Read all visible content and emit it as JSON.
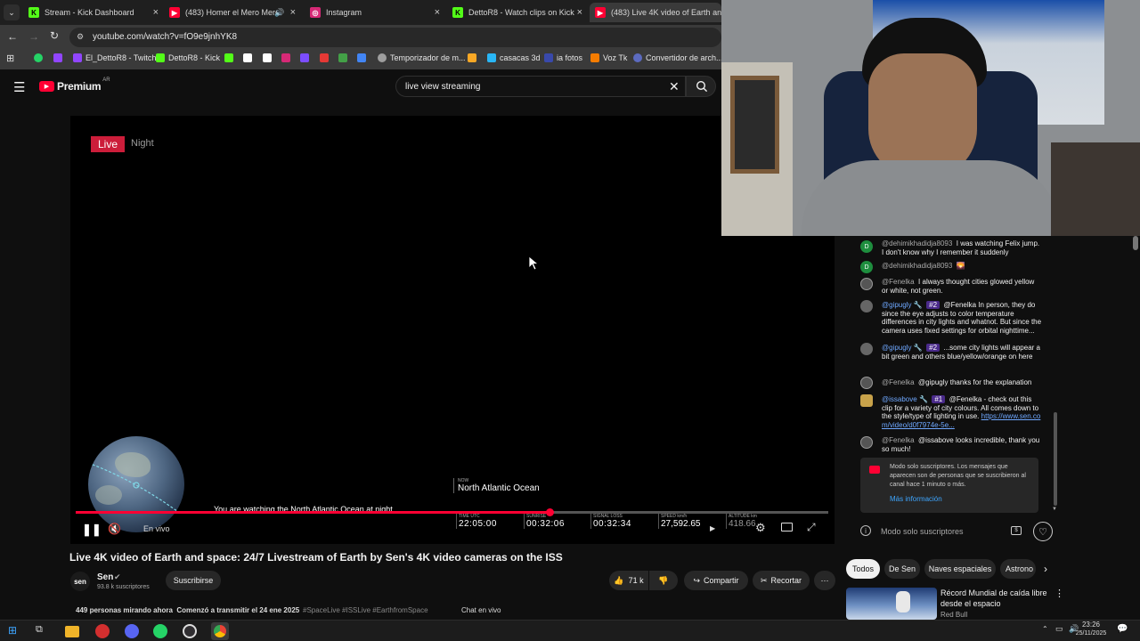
{
  "browser": {
    "tabs": [
      {
        "label": "Stream - Kick Dashboard",
        "icon": "kick-icon",
        "color": "#53fc18"
      },
      {
        "label": "(483) Homer el Mero Mero",
        "icon": "youtube-icon",
        "color": "#ff0033"
      },
      {
        "label": "Instagram",
        "icon": "instagram-icon",
        "color": "#d62976"
      },
      {
        "label": "DettoR8 - Watch clips on Kick",
        "icon": "kick-icon",
        "color": "#53fc18"
      },
      {
        "label": "(483) Live 4K video of Earth and",
        "icon": "youtube-icon",
        "color": "#ff0033"
      }
    ],
    "url": "youtube.com/watch?v=fO9e9jnhYK8",
    "bookmarks": [
      {
        "label": "",
        "icon": "whatsapp-icon",
        "color": "#25d366"
      },
      {
        "label": "",
        "icon": "twitch-icon",
        "color": "#9146ff"
      },
      {
        "label": "El_DettoR8 - Twitch",
        "icon": "twitch-icon",
        "color": "#9146ff"
      },
      {
        "label": "DettoR8 - Kick",
        "icon": "kick-icon",
        "color": "#53fc18"
      },
      {
        "label": "",
        "icon": "kick-icon",
        "color": "#53fc18"
      },
      {
        "label": "",
        "icon": "tiktok-icon",
        "color": "#ffffff"
      },
      {
        "label": "",
        "icon": "x-icon",
        "color": "#ffffff"
      },
      {
        "label": "",
        "icon": "instagram-icon",
        "color": "#d62976"
      },
      {
        "label": "",
        "icon": "app-icon",
        "color": "#7c4dff"
      },
      {
        "label": "",
        "icon": "app-icon",
        "color": "#e53935"
      },
      {
        "label": "",
        "icon": "app-icon",
        "color": "#43a047"
      },
      {
        "label": "",
        "icon": "app-icon",
        "color": "#4285f4"
      },
      {
        "label": "Temporizador de m...",
        "icon": "timer-icon",
        "color": "#9e9e9e"
      },
      {
        "label": "",
        "icon": "app-icon",
        "color": "#f9a825"
      },
      {
        "label": "casacas 3d",
        "icon": "shirt-icon",
        "color": "#29b6f6"
      },
      {
        "label": "ia fotos",
        "icon": "app-icon",
        "color": "#3949ab"
      },
      {
        "label": "Voz Tk",
        "icon": "bookmark-icon",
        "color": "#f57c00"
      },
      {
        "label": "Convertidor de arch...",
        "icon": "converter-icon",
        "color": "#5c6bc0"
      }
    ]
  },
  "youtube": {
    "logo": "Premium",
    "region": "AR",
    "search_value": "live view streaming"
  },
  "player": {
    "live_badge": "Live",
    "night_label": "Night",
    "watching_text": "You are watching the North Atlantic Ocean at night.",
    "now_label": "NOW",
    "location": "North Atlantic Ocean",
    "stats": [
      {
        "label": "TIME UTC",
        "value": "22:05:00"
      },
      {
        "label": "SUNRISE",
        "value": "00:32:06"
      },
      {
        "label": "SIGNAL LOSS",
        "value": "00:32:34"
      },
      {
        "label": "SPEED km/h",
        "value": "27,592.65"
      },
      {
        "label": "ALTITUDE km",
        "value": "418.66"
      }
    ],
    "live_status": "En vivo",
    "progress": 0.63
  },
  "video": {
    "title": "Live 4K video of Earth and space: 24/7 Livestream of Earth by Sen's 4K video cameras on the ISS",
    "channel": "Sen",
    "subscribers": "93.8 k suscriptores",
    "subscribe_label": "Suscribirse",
    "likes": "71 k",
    "share_label": "Compartir",
    "clip_label": "Recortar",
    "meta": "449 personas mirando ahora  Comenzó a transmitir el 24 ene 2025",
    "hashtags": "#SpaceLive #ISSLive #EarthfromSpace",
    "chat_label": "Chat en vivo"
  },
  "chat": {
    "messages": [
      {
        "author": "@dehimikhadidja8093",
        "text": "I was watching Felix jump. I don't know why I remember it suddenly",
        "avatar": "D",
        "color": "#1e8e3e"
      },
      {
        "author": "@dehimikhadidja8093",
        "text": "🌄",
        "avatar": "D",
        "color": "#1e8e3e"
      },
      {
        "author": "@Fenelka",
        "text": "I always thought cities glowed yellow or white, not green.",
        "avatar": "",
        "color": "#555555"
      },
      {
        "author": "@gipugly",
        "badge": "#2",
        "text": "@Fenelka In person, they do since the eye adjusts to color temperature differences in city lights and whatnot. But since the camera uses fixed settings for orbital nighttime...",
        "avatar": "",
        "color": "#666666"
      },
      {
        "author": "@gipugly",
        "badge": "#2",
        "text": "...some city lights will appear a bit green and others blue/yellow/orange on here",
        "avatar": "",
        "color": "#666666"
      },
      {
        "author": "@Fenelka",
        "text": "@gipugly thanks for the explanation",
        "avatar": "",
        "color": "#555555"
      },
      {
        "author": "@issabove",
        "badge": "#1",
        "text": "@Fenelka - check out this clip for a variety of city colours. All comes down to the style/type of lighting in use.",
        "link": "https://www.sen.com/video/d0f7974e-5e...",
        "avatar": "",
        "color": "#c8a24a"
      },
      {
        "author": "@Fenelka",
        "text": "@issabove looks incredible, thank you so much!",
        "avatar": "",
        "color": "#555555"
      }
    ],
    "subs_notice": "Modo solo suscriptores. Los mensajes que aparecen son de personas que se suscribieron al canal hace 1 minuto o más.",
    "more_info": "Más información",
    "input_placeholder": "Modo solo suscriptores"
  },
  "related": {
    "chips": [
      "Todos",
      "De Sen",
      "Naves espaciales",
      "Astrono"
    ],
    "first_title": "Récord Mundial de caída libre desde el espacio",
    "first_channel": "Red Bull"
  },
  "taskbar": {
    "time": "23:26",
    "date": "25/11/2025"
  }
}
